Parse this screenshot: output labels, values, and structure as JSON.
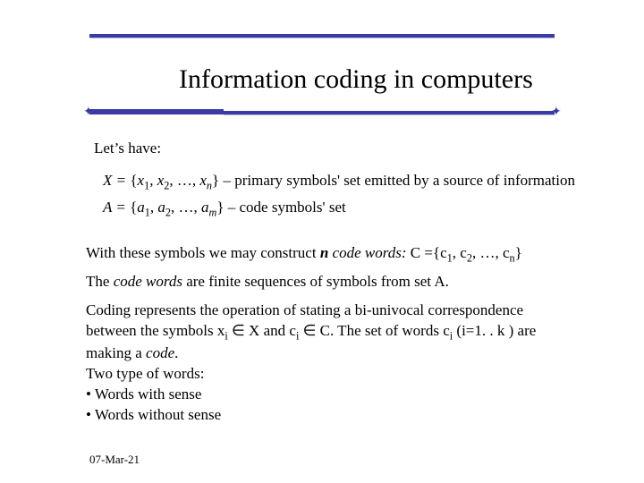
{
  "title": "Information coding in computers",
  "lets_have": "Let’s have:",
  "math": {
    "x_lhs": "X = ",
    "x_set_open": "{",
    "x_items": [
      "x",
      "1",
      ", ",
      "x",
      "2",
      ", …, ",
      "x",
      "n"
    ],
    "x_set_close": "}",
    "x_desc": " – primary symbols' set emitted by a source of information",
    "a_lhs": "A = ",
    "a_set_open": "{",
    "a_items": [
      "a",
      "1",
      ", ",
      "a",
      "2",
      ", …, ",
      "a",
      "m"
    ],
    "a_set_close": "}",
    "a_desc": " – code symbols' set"
  },
  "p1": {
    "pre": "With these symbols we may construct ",
    "n": "n",
    "code_words": " code words:",
    "c_eq": " C ={c",
    "s1": "1",
    "comma1": ", c",
    "s2": "2",
    "mid": ", …, c",
    "sn": "n",
    "close": "}"
  },
  "p2": {
    "pre": "The ",
    "cw": "code words",
    "post": " are finite sequences of symbols from set A."
  },
  "p3": {
    "l1a": "Coding represents the operation of stating a bi-univocal correspondence",
    "l2a": "between the symbols x",
    "l2sub1": "i",
    "l2b": " ∈ X and c",
    "l2sub2": "i",
    "l2c": " ∈ C. The set of words c",
    "l2sub3": "i",
    "l2d": " (i=1. . k ) are",
    "l3a": "making a ",
    "l3code": "code",
    "l3b": ".",
    "l4": "Two type of words:",
    "l5": "• Words with sense",
    "l6": "• Words without sense"
  },
  "footer_date": "07-Mar-21"
}
